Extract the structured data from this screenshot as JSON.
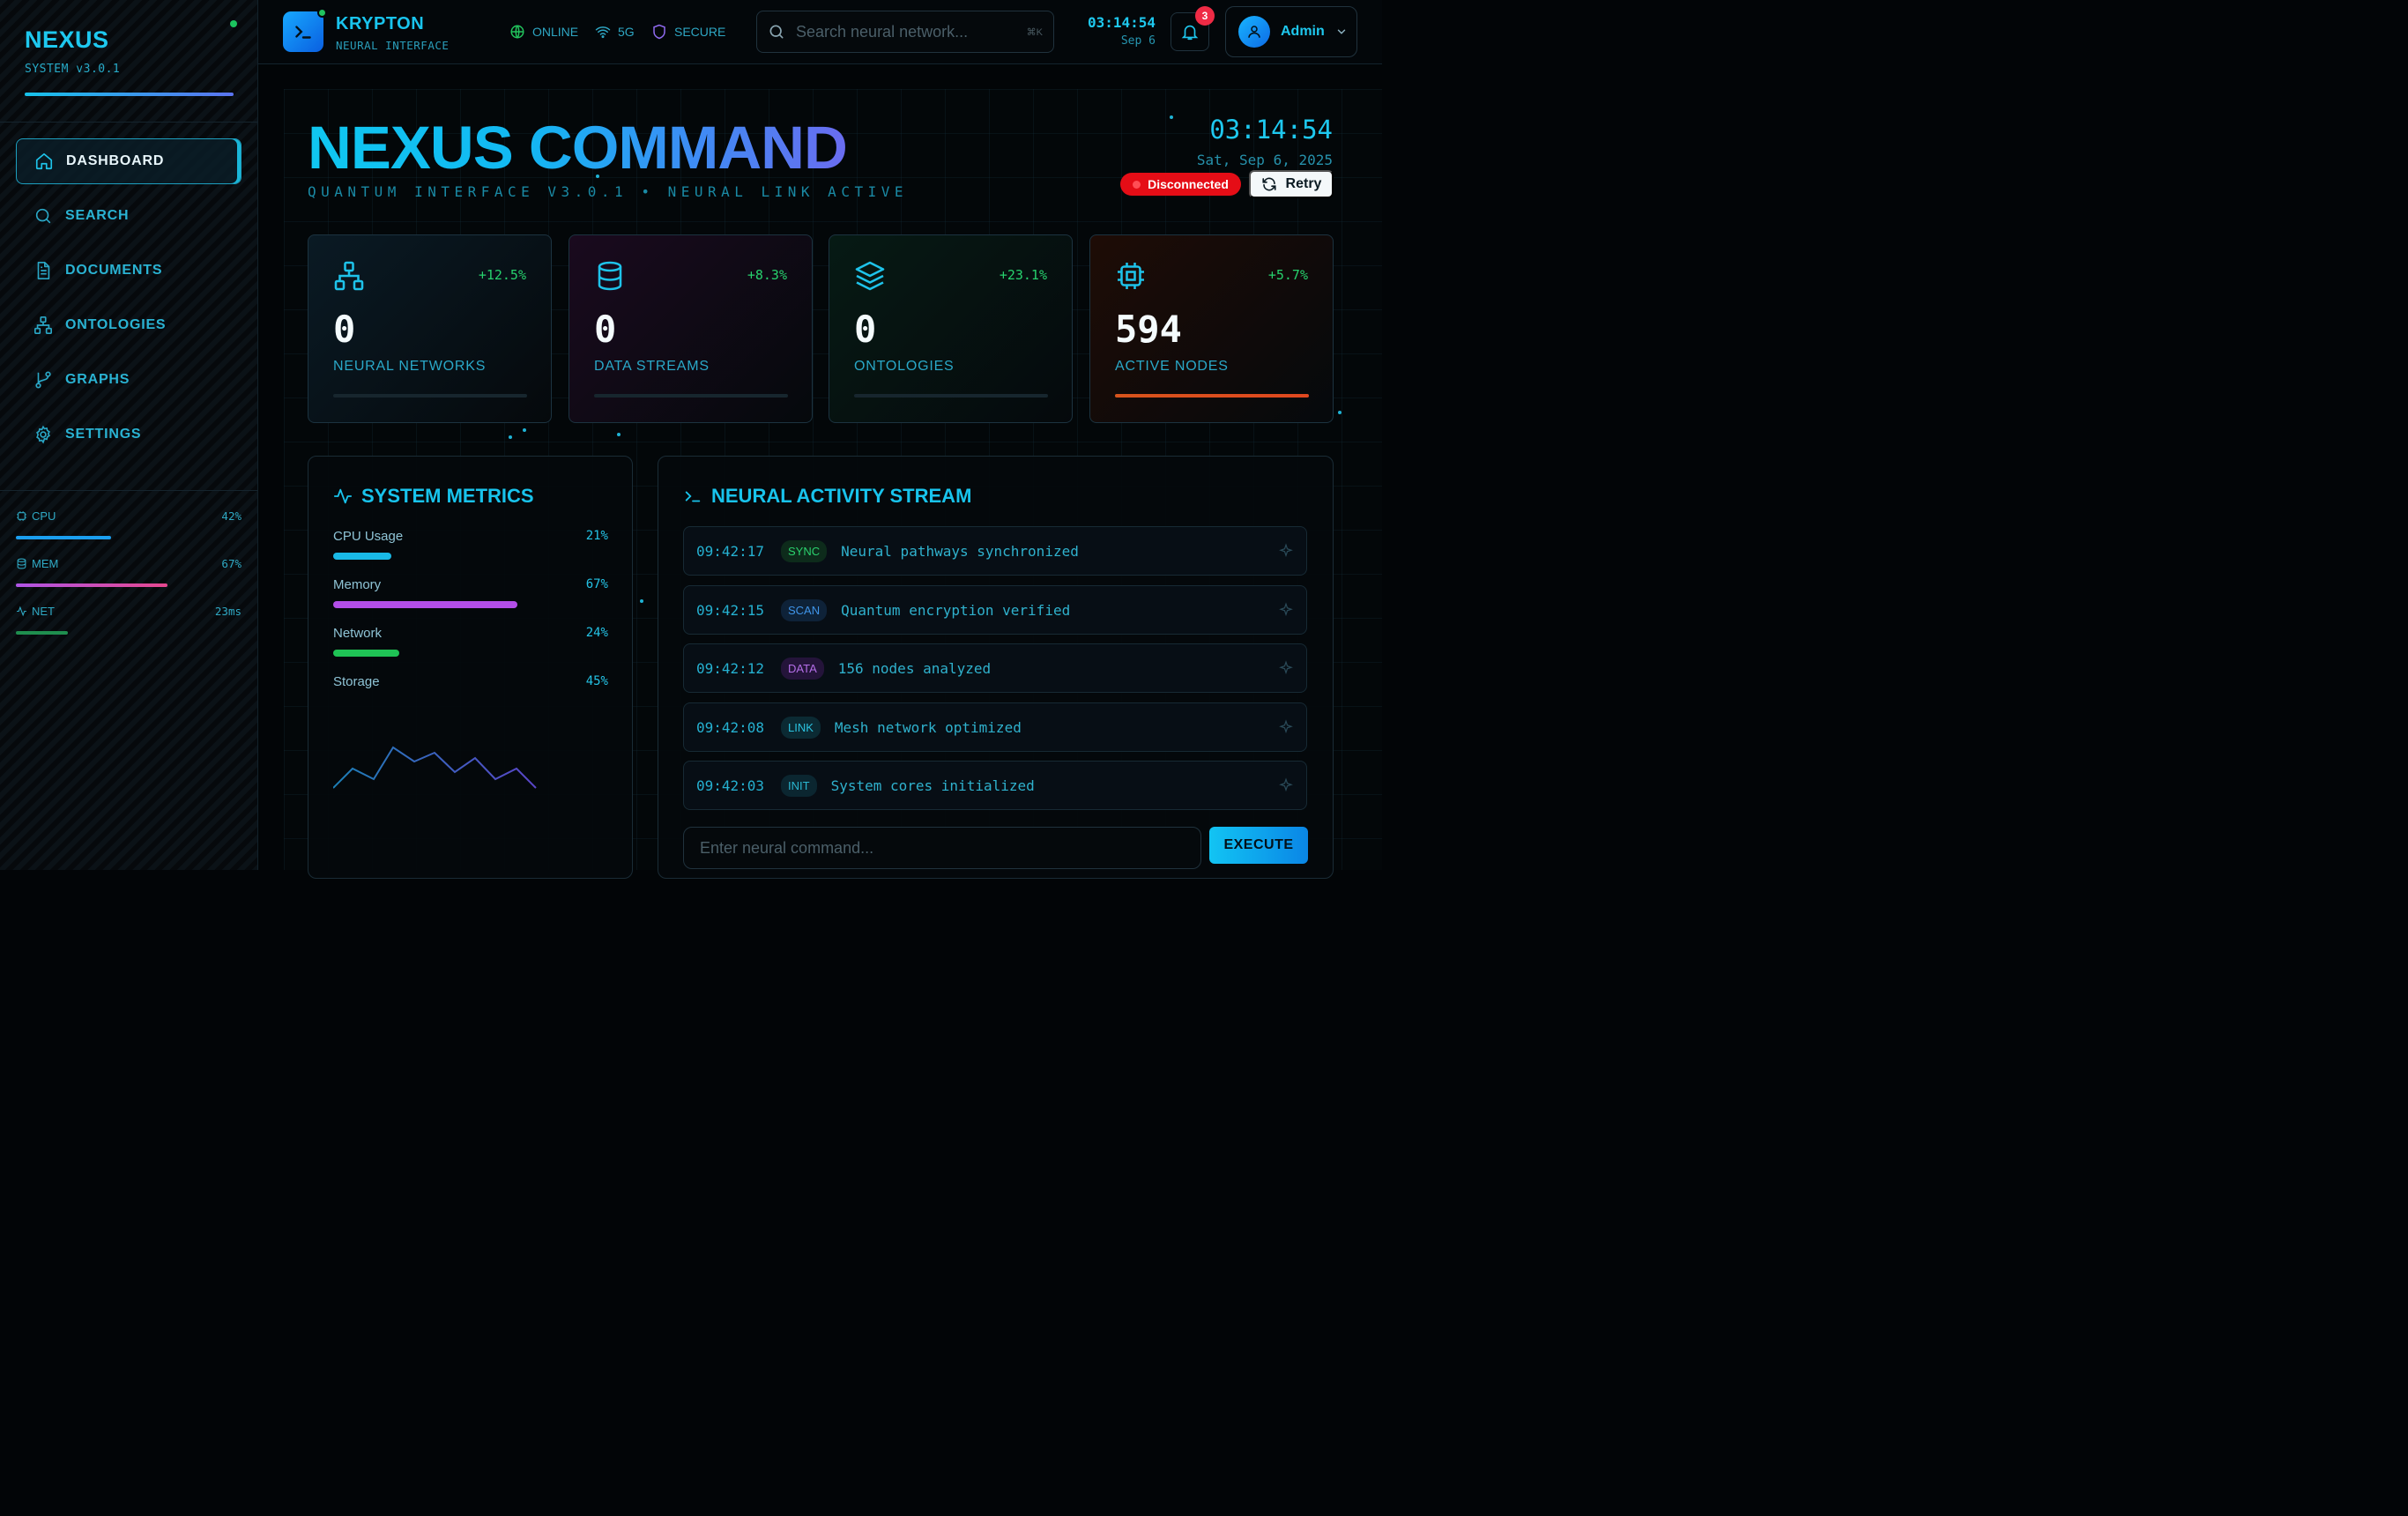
{
  "sidebar": {
    "brand_title": "NEXUS",
    "brand_version": "SYSTEM v3.0.1",
    "nav": [
      {
        "label": "DASHBOARD",
        "icon": "home-icon",
        "active": true
      },
      {
        "label": "SEARCH",
        "icon": "search-icon"
      },
      {
        "label": "DOCUMENTS",
        "icon": "document-icon"
      },
      {
        "label": "ONTOLOGIES",
        "icon": "network-icon"
      },
      {
        "label": "GRAPHS",
        "icon": "git-branch-icon"
      },
      {
        "label": "SETTINGS",
        "icon": "gear-icon"
      }
    ],
    "mini_metrics": [
      {
        "label": "CPU",
        "value": "42%",
        "level": 0.42,
        "color": "#1b9ff0"
      },
      {
        "label": "MEM",
        "value": "67%",
        "level": 0.67,
        "color": "#c657e8"
      },
      {
        "label": "NET",
        "value": "23ms",
        "level": 0.23,
        "color": "#1f8e4f"
      }
    ]
  },
  "header": {
    "app_name": "KRYPTON",
    "app_sub": "NEURAL INTERFACE",
    "status": [
      {
        "label": "ONLINE",
        "icon": "globe-icon",
        "color": "#22c35c"
      },
      {
        "label": "5G",
        "icon": "wifi-icon",
        "color": "#2ea6c3"
      },
      {
        "label": "SECURE",
        "icon": "shield-icon",
        "color": "#8f6af0"
      }
    ],
    "search_placeholder": "Search neural network...",
    "search_shortcut": "⌘K",
    "time": "03:14:54",
    "date": "Sep 6",
    "notifications": "3",
    "user": "Admin"
  },
  "hero": {
    "title": "NEXUS COMMAND",
    "subtitle": "QUANTUM INTERFACE V3.0.1 • NEURAL LINK ACTIVE",
    "clock": "03:14:54",
    "date": "Sat, Sep 6, 2025",
    "connection_status": "Disconnected",
    "retry_label": "Retry"
  },
  "stats": [
    {
      "value": "0",
      "label": "NEURAL NETWORKS",
      "change": "+12.5%",
      "icon": "network-icon",
      "level": 0,
      "tint": "#0a1a24",
      "bar": "#1e6fa0"
    },
    {
      "value": "0",
      "label": "DATA STREAMS",
      "change": "+8.3%",
      "icon": "database-icon",
      "level": 0,
      "tint": "#1a0a1e",
      "bar": "#c03fd0"
    },
    {
      "value": "0",
      "label": "ONTOLOGIES",
      "change": "+23.1%",
      "icon": "layers-icon",
      "level": 0,
      "tint": "#061a14",
      "bar": "#1fae6c"
    },
    {
      "value": "594",
      "label": "ACTIVE NODES",
      "change": "+5.7%",
      "icon": "cpu-icon",
      "level": 1,
      "tint": "#1e0c06",
      "bar": "#e0481f"
    }
  ],
  "metrics_panel": {
    "title": "SYSTEM METRICS",
    "items": [
      {
        "label": "CPU Usage",
        "value": "21%",
        "level": 0.21,
        "color": "#19b9e6"
      },
      {
        "label": "Memory",
        "value": "67%",
        "level": 0.67,
        "color": "#b34ee8"
      },
      {
        "label": "Network",
        "value": "24%",
        "level": 0.24,
        "color": "#1fc355"
      },
      {
        "label": "Storage",
        "value": "45%",
        "level": 0,
        "color": "#d8a21a"
      }
    ]
  },
  "activity": {
    "title": "NEURAL ACTIVITY STREAM",
    "entries": [
      {
        "time": "09:42:17",
        "tag": "SYNC",
        "message": "Neural pathways synchronized",
        "tag_color": "#2bd26e",
        "tag_bg": "#0d2b1b"
      },
      {
        "time": "09:42:15",
        "tag": "SCAN",
        "message": "Quantum encryption verified",
        "tag_color": "#3f94e8",
        "tag_bg": "#0e2238"
      },
      {
        "time": "09:42:12",
        "tag": "DATA",
        "message": "156 nodes analyzed",
        "tag_color": "#b46ee8",
        "tag_bg": "#24143a"
      },
      {
        "time": "09:42:08",
        "tag": "LINK",
        "message": "Mesh network optimized",
        "tag_color": "#2bc3e0",
        "tag_bg": "#0b2a33"
      },
      {
        "time": "09:42:03",
        "tag": "INIT",
        "message": "System cores initialized",
        "tag_color": "#2ab6d0",
        "tag_bg": "#0b2630"
      }
    ],
    "command_placeholder": "Enter neural command...",
    "execute_label": "EXECUTE"
  }
}
